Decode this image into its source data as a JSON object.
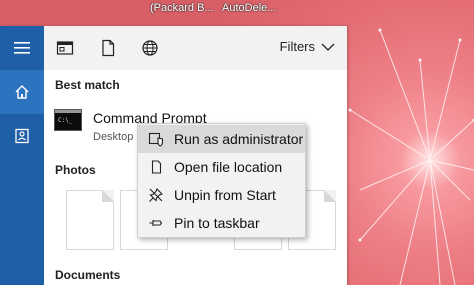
{
  "desktop": {
    "labels": [
      "(Packard B...",
      "AutoDele..."
    ]
  },
  "rail": {
    "items": [
      {
        "icon": "hamburger-menu-icon"
      },
      {
        "icon": "home-icon"
      },
      {
        "icon": "notebook-icon"
      }
    ]
  },
  "toolbar": {
    "icons": [
      "apps-icon",
      "documents-icon",
      "web-icon"
    ],
    "filters_label": "Filters"
  },
  "results": {
    "best_match_title": "Best match",
    "best_match": {
      "name": "Command Prompt",
      "subtitle": "Desktop"
    },
    "photos_title": "Photos",
    "documents_title": "Documents"
  },
  "context_menu": {
    "items": [
      {
        "label": "Run as administrator",
        "icon": "shield-icon"
      },
      {
        "label": "Open file location",
        "icon": "folder-icon"
      },
      {
        "label": "Unpin from Start",
        "icon": "unpin-icon"
      },
      {
        "label": "Pin to taskbar",
        "icon": "pin-icon"
      }
    ]
  },
  "colors": {
    "rail": "#1f5fa7",
    "rail_active": "#2c74bf",
    "menu_hover": "#dadada"
  }
}
